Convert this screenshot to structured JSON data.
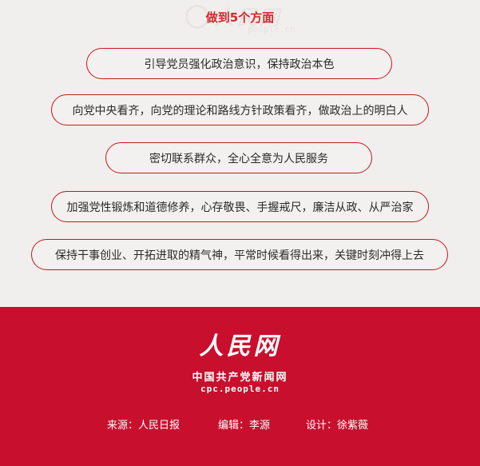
{
  "watermark": {
    "text": "人民网",
    "sub": "people.cn"
  },
  "heading": "做到5个方面",
  "items": [
    "引导党员强化政治意识，保持政治本色",
    "向党中央看齐，向党的理论和路线方针政策看齐，做政治上的明白人",
    "密切联系群众，全心全意为人民服务",
    "加强党性锻炼和道德修养，心存敬畏、手握戒尺，廉洁从政、从严治家",
    "保持干事创业、开拓进取的精气神，平常时候看得出来，关键时刻冲得上去"
  ],
  "footer": {
    "logo": "人民网",
    "logo_sub": "中国共产党新闻网",
    "logo_url": "cpc.people.cn",
    "credits": [
      "来源：人民日报",
      "编辑：李源",
      "设计：徐紫薇"
    ]
  },
  "colors": {
    "accent": "#c8102e",
    "background": "#f1efed"
  }
}
